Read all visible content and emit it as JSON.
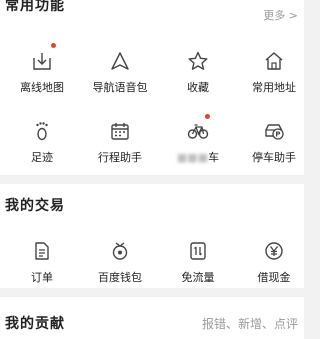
{
  "functions": {
    "title": "常用功能",
    "more": "更多 >",
    "items": [
      {
        "label": "离线地图",
        "icon": "offline-map-icon"
      },
      {
        "label": "导航语音包",
        "icon": "navigation-voice-icon"
      },
      {
        "label": "收藏",
        "icon": "star-icon"
      },
      {
        "label": "常用地址",
        "icon": "home-icon"
      },
      {
        "label": "足迹",
        "icon": "footprint-icon"
      },
      {
        "label": "行程助手",
        "icon": "calendar-icon"
      },
      {
        "label": "车",
        "icon": "bicycle-icon"
      },
      {
        "label": "停车助手",
        "icon": "parking-car-icon"
      }
    ]
  },
  "trade": {
    "title": "我的交易",
    "items": [
      {
        "label": "订单",
        "icon": "document-icon"
      },
      {
        "label": "百度钱包",
        "icon": "wallet-icon"
      },
      {
        "label": "免流量",
        "icon": "data-free-icon"
      },
      {
        "label": "借现金",
        "icon": "yuan-icon"
      }
    ]
  },
  "contrib": {
    "title": "我的贡献",
    "subtitle": "报错、新增、点评"
  },
  "colors": {
    "accent": "#e8412c",
    "icon": "#444444",
    "background": "#f2f2f2"
  }
}
